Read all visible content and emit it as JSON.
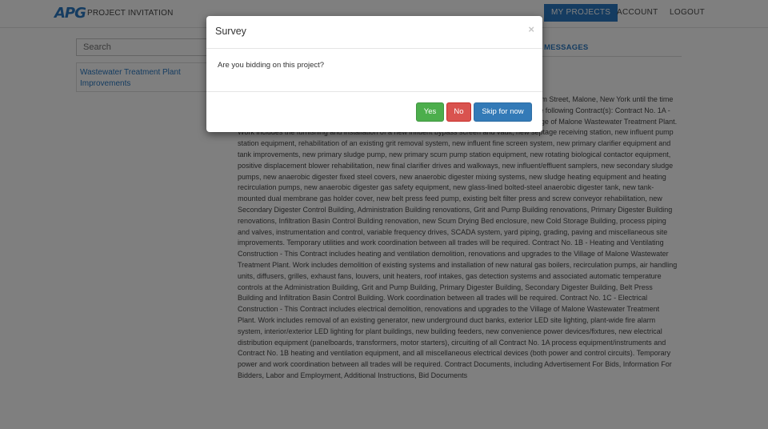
{
  "header": {
    "logo_text": "APG",
    "brand_text": "PROJECT INVITATION",
    "nav": {
      "my_projects": "MY PROJECTS",
      "account": "ACCOUNT",
      "logout": "LOGOUT"
    }
  },
  "sidebar": {
    "search_placeholder": "Search",
    "projects": [
      "Wastewater Treatment Plant Improvements"
    ]
  },
  "main": {
    "tab_messages": "MESSAGES",
    "description": "Sealed bids for the Malone Wastewater Treatment Plant Improvements will be received at 14 Elm Street, Malone, New York until the time specified, at which time they will be publicly opened and read aloud. Bids will be received for the following Contract(s): Contract No. 1A - General Construction - This Contract includes demolition, renovations and upgrades to the Village of Malone Wastewater Treatment Plant. Work includes the furnishing and installation of a new influent bypass screen and vault, new septage receiving station, new influent pump station equipment, rehabilitation of an existing grit removal system, new influent fine screen system, new primary clarifier equipment and tank improvements, new primary sludge pump, new primary scum pump station equipment, new rotating biological contactor equipment, positive displacement blower rehabilitation, new final clarifier drives and walkways, new influent/effluent samplers, new secondary sludge pumps, new anaerobic digester fixed steel covers, new anaerobic digester mixing systems, new sludge heating equipment and heating recirculation pumps, new anaerobic digester gas safety equipment, new glass-lined bolted-steel anaerobic digester tank, new tank-mounted dual membrane gas holder cover, new belt press feed pump, existing belt filter press and screw conveyor rehabilitation, new Secondary Digester Control Building, Administration Building renovations, Grit and Pump Building renovations, Primary Digester Building renovations, Infiltration Basin Control Building renovation, new Scum Drying Bed enclosure, new Cold Storage Building, process piping and valves, instrumentation and control, variable frequency drives, SCADA system, yard piping, grading, paving and miscellaneous site improvements. Temporary utilities and work coordination between all trades will be required. Contract No. 1B - Heating and Ventilating Construction - This Contract includes heating and ventilation demolition, renovations and upgrades to the Village of Malone Wastewater Treatment Plant. Work includes demolition of existing systems and installation of new natural gas boilers, recirculation pumps, air handling units, diffusers, grilles, exhaust fans, louvers, unit heaters, roof intakes, gas detection systems and associated automatic temperature controls at the Administration Building, Grit and Pump Building, Primary Digester Building, Secondary Digester Building, Belt Press Building and Infiltration Basin Control Building. Work coordination between all trades will be required. Contract No. 1C - Electrical Construction - This Contract includes electrical demolition, renovations and upgrades to the Village of Malone Wastewater Treatment Plant. Work includes removal of an existing generator, new underground duct banks, exterior LED site lighting, plant-wide fire alarm system, interior/exterior LED lighting for plant buildings, new building feeders, new convenience power devices/fixtures, new electrical distribution equipment (panelboards, transformers, motor starters), circuiting of all Contract No. 1A process equipment/instruments and Contract No. 1B heating and ventilation equipment, and all miscellaneous electrical devices (both power and control circuits). Temporary power and work coordination between all trades will be required. Contract Documents, including Advertisement For Bids, Information For Bidders, Labor and Employment, Additional Instructions, Bid Documents"
  },
  "modal": {
    "title": "Survey",
    "close_glyph": "×",
    "question": "Are you bidding on this project?",
    "buttons": {
      "yes": "Yes",
      "no": "No",
      "skip": "Skip for now"
    }
  },
  "colors": {
    "brand_blue": "#2b79c2",
    "success": "#4cae4c",
    "danger": "#d9534f",
    "primary": "#337ab7"
  }
}
